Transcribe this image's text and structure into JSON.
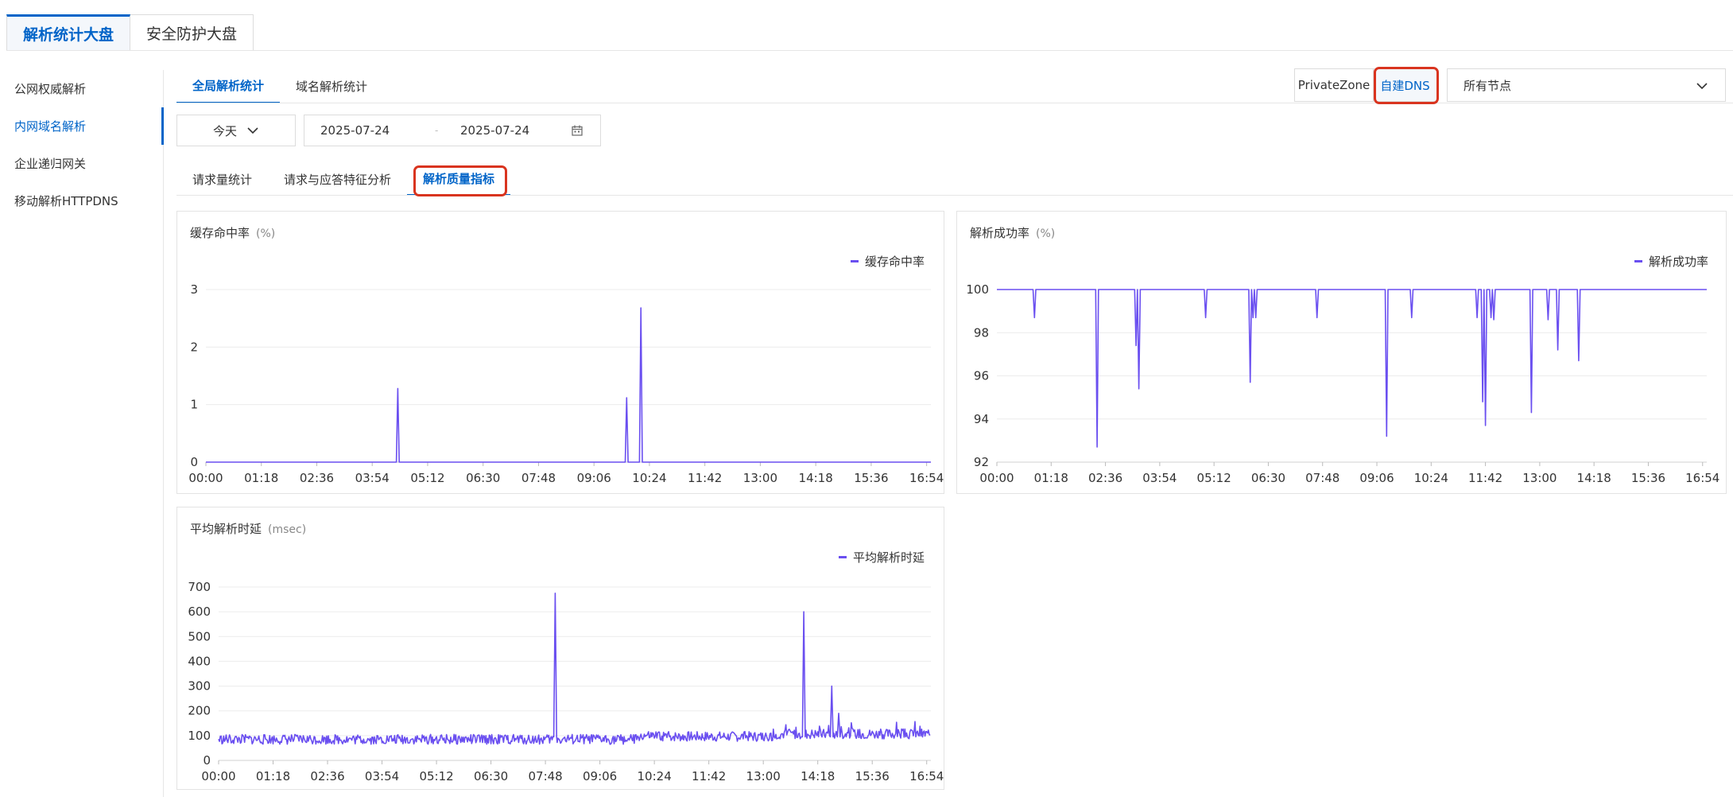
{
  "top_tabs": [
    {
      "label": "解析统计大盘",
      "active": true
    },
    {
      "label": "安全防护大盘",
      "active": false
    }
  ],
  "sidebar": {
    "items": [
      {
        "label": "公网权威解析"
      },
      {
        "label": "内网域名解析"
      },
      {
        "label": "企业递归网关"
      },
      {
        "label": "移动解析HTTPDNS"
      }
    ],
    "active_index": 1
  },
  "sub_tabs": [
    {
      "label": "全局解析统计"
    },
    {
      "label": "域名解析统计"
    }
  ],
  "scope": {
    "private_zone": "PrivateZone",
    "self_dns": "自建DNS",
    "node_select": "所有节点"
  },
  "filters": {
    "day": "今天",
    "date_start": "2025-07-24",
    "date_sep": "-",
    "date_end": "2025-07-24"
  },
  "metric_tabs": [
    {
      "label": "请求量统计"
    },
    {
      "label": "请求与应答特征分析"
    },
    {
      "label": "解析质量指标"
    }
  ],
  "colors": {
    "accent": "#0064c8",
    "series": "#6a4ff0",
    "highlight": "#d9341f"
  },
  "chart_data": [
    {
      "type": "line",
      "title": "缓存命中率",
      "unit": "(%)",
      "legend": "缓存命中率",
      "legend_position": "top-right",
      "grid": true,
      "ylim": [
        0,
        3
      ],
      "yticks": [
        0,
        1,
        2,
        3
      ],
      "xticks": [
        "00:00",
        "01:18",
        "02:36",
        "03:54",
        "05:12",
        "06:30",
        "07:48",
        "09:06",
        "10:24",
        "11:42",
        "13:00",
        "14:18",
        "15:36",
        "16:54"
      ],
      "x_range": [
        "00:00",
        "17:00"
      ],
      "baseline": 0,
      "noise": 0,
      "spikes": [
        {
          "x": "04:30",
          "y": 1.28
        },
        {
          "x": "09:52",
          "y": 1.12
        },
        {
          "x": "10:12",
          "y": 2.68
        }
      ]
    },
    {
      "type": "line",
      "title": "解析成功率",
      "unit": "(%)",
      "legend": "解析成功率",
      "legend_position": "top-right",
      "grid": true,
      "ylim": [
        92,
        100
      ],
      "yticks": [
        92,
        94,
        96,
        98,
        100
      ],
      "xticks": [
        "00:00",
        "01:18",
        "02:36",
        "03:54",
        "05:12",
        "06:30",
        "07:48",
        "09:06",
        "10:24",
        "11:42",
        "13:00",
        "14:18",
        "15:36",
        "16:54"
      ],
      "x_range": [
        "00:00",
        "17:00"
      ],
      "baseline": 100,
      "noise": 0,
      "spikes": [
        {
          "x": "00:54",
          "y": 98.7
        },
        {
          "x": "02:24",
          "y": 92.7
        },
        {
          "x": "03:20",
          "y": 97.4
        },
        {
          "x": "03:24",
          "y": 95.4
        },
        {
          "x": "05:00",
          "y": 98.7
        },
        {
          "x": "06:04",
          "y": 95.7
        },
        {
          "x": "06:08",
          "y": 98.7
        },
        {
          "x": "06:12",
          "y": 98.7
        },
        {
          "x": "07:40",
          "y": 98.7
        },
        {
          "x": "09:20",
          "y": 93.2
        },
        {
          "x": "09:56",
          "y": 98.7
        },
        {
          "x": "11:30",
          "y": 98.7
        },
        {
          "x": "11:38",
          "y": 94.8
        },
        {
          "x": "11:42",
          "y": 93.7
        },
        {
          "x": "11:50",
          "y": 98.7
        },
        {
          "x": "11:54",
          "y": 98.6
        },
        {
          "x": "12:48",
          "y": 94.3
        },
        {
          "x": "13:12",
          "y": 98.6
        },
        {
          "x": "13:26",
          "y": 97.2
        },
        {
          "x": "13:56",
          "y": 96.7
        }
      ]
    },
    {
      "type": "line",
      "title": "平均解析时延",
      "unit": "(msec)",
      "legend": "平均解析时延",
      "legend_position": "top-right",
      "grid": true,
      "ylim": [
        0,
        700
      ],
      "yticks": [
        0,
        100,
        200,
        300,
        400,
        500,
        600,
        700
      ],
      "xticks": [
        "00:00",
        "01:18",
        "02:36",
        "03:54",
        "05:12",
        "06:30",
        "07:48",
        "09:06",
        "10:24",
        "11:42",
        "13:00",
        "14:18",
        "15:36",
        "16:54"
      ],
      "x_range": [
        "00:00",
        "17:00"
      ],
      "baseline": 95,
      "noise": 20,
      "spikes": [
        {
          "x": "08:02",
          "y": 675
        },
        {
          "x": "13:58",
          "y": 600
        },
        {
          "x": "14:38",
          "y": 300
        },
        {
          "x": "14:48",
          "y": 190
        }
      ]
    }
  ]
}
